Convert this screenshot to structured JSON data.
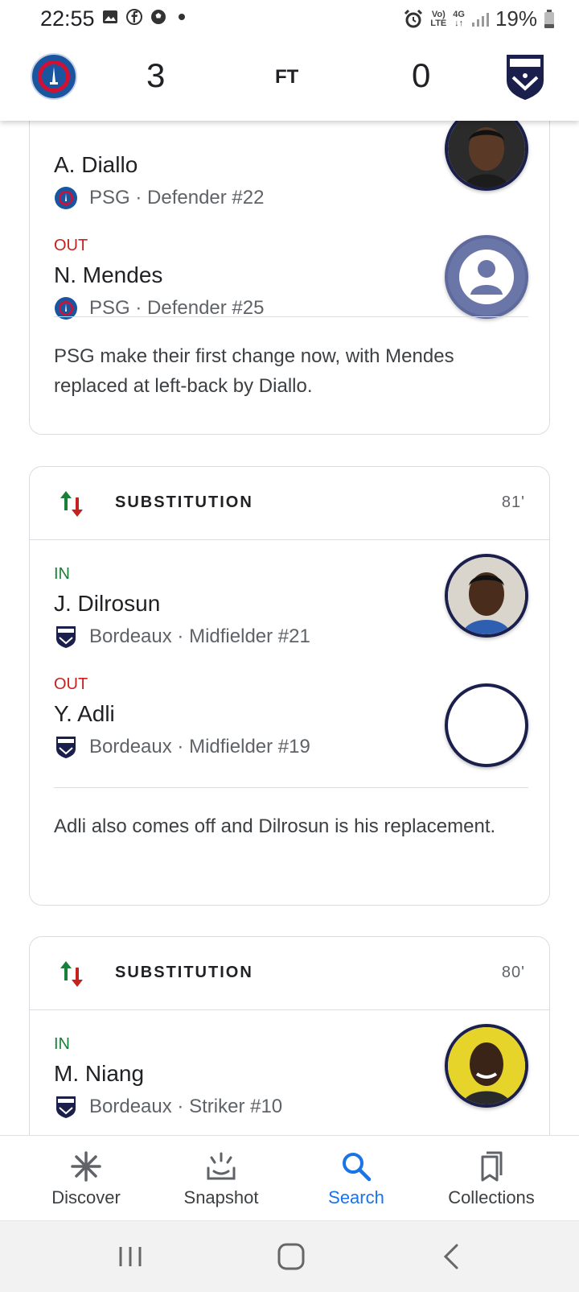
{
  "status_bar": {
    "time": "22:55",
    "network_top": "Vo)",
    "network_bottom": "LTE",
    "gen": "4G",
    "battery": "19%"
  },
  "match": {
    "home_score": "3",
    "status": "FT",
    "away_score": "0",
    "colors": {
      "psg_blue": "#1a56a0",
      "psg_red": "#d21034",
      "bordeaux_navy": "#1a1f4b"
    }
  },
  "cards": [
    {
      "players": [
        {
          "tag": "",
          "name": "A. Diallo",
          "team": "PSG",
          "role": "Defender #22"
        },
        {
          "tag": "OUT",
          "name": "N. Mendes",
          "team": "PSG",
          "role": "Defender #25"
        }
      ],
      "comment": "PSG make their first change now, with Mendes replaced at left-back by Diallo."
    },
    {
      "type": "SUBSTITUTION",
      "minute": "81'",
      "players": [
        {
          "tag": "IN",
          "name": "J. Dilrosun",
          "team": "Bordeaux",
          "role": "Midfielder #21"
        },
        {
          "tag": "OUT",
          "name": "Y. Adli",
          "team": "Bordeaux",
          "role": "Midfielder #19"
        }
      ],
      "comment": "Adli also comes off and Dilrosun is his replacement."
    },
    {
      "type": "SUBSTITUTION",
      "minute": "80'",
      "players": [
        {
          "tag": "IN",
          "name": "M. Niang",
          "team": "Bordeaux",
          "role": "Striker #10"
        }
      ]
    }
  ],
  "separator": "·",
  "bottom_nav": [
    {
      "label": "Discover",
      "icon": "asterisk-icon",
      "active": false
    },
    {
      "label": "Snapshot",
      "icon": "snapshot-icon",
      "active": false
    },
    {
      "label": "Search",
      "icon": "search-icon",
      "active": true
    },
    {
      "label": "Collections",
      "icon": "bookmarks-icon",
      "active": false
    }
  ],
  "accent": "#1a73e8"
}
